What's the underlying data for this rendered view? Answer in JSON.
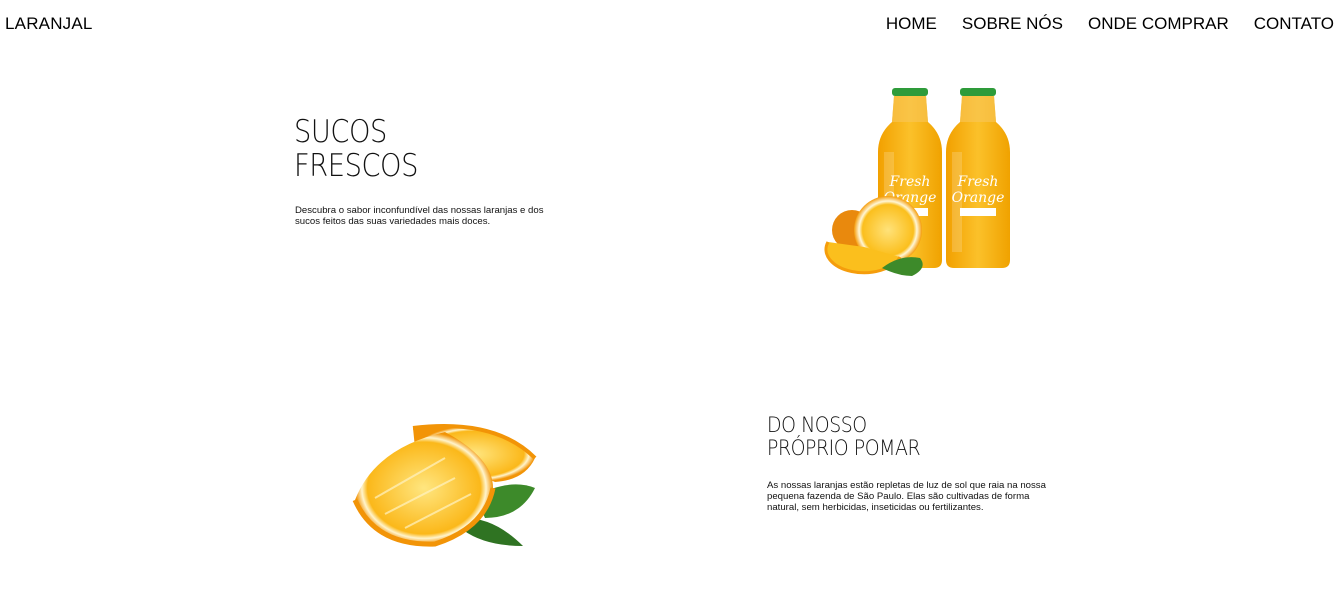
{
  "header": {
    "logo": "LARANJAL",
    "nav": [
      {
        "label": "HOME"
      },
      {
        "label": "SOBRE NÓS"
      },
      {
        "label": "ONDE COMPRAR"
      },
      {
        "label": "CONTATO"
      }
    ]
  },
  "hero": {
    "title_line1": "SUCOS",
    "title_line2": "FRESCOS",
    "description": "Descubra o sabor inconfundível das nossas laranjas e dos sucos feitos das suas variedades mais doces.",
    "image_label_line1": "Fresh",
    "image_label_line2": "Orange"
  },
  "orchard": {
    "title_line1": "DO NOSSO",
    "title_line2": "PRÓPRIO POMAR",
    "description": "As nossas laranjas estão repletas de luz de sol que raia na nossa pequena fazenda de São Paulo. Elas são cultivadas de forma natural, sem herbicidas, inseticidas ou fertilizantes."
  },
  "colors": {
    "orange": "#f7a81b",
    "juice": "#f9b314",
    "cap": "#2e9b3a",
    "leaf": "#3d8a2a"
  }
}
